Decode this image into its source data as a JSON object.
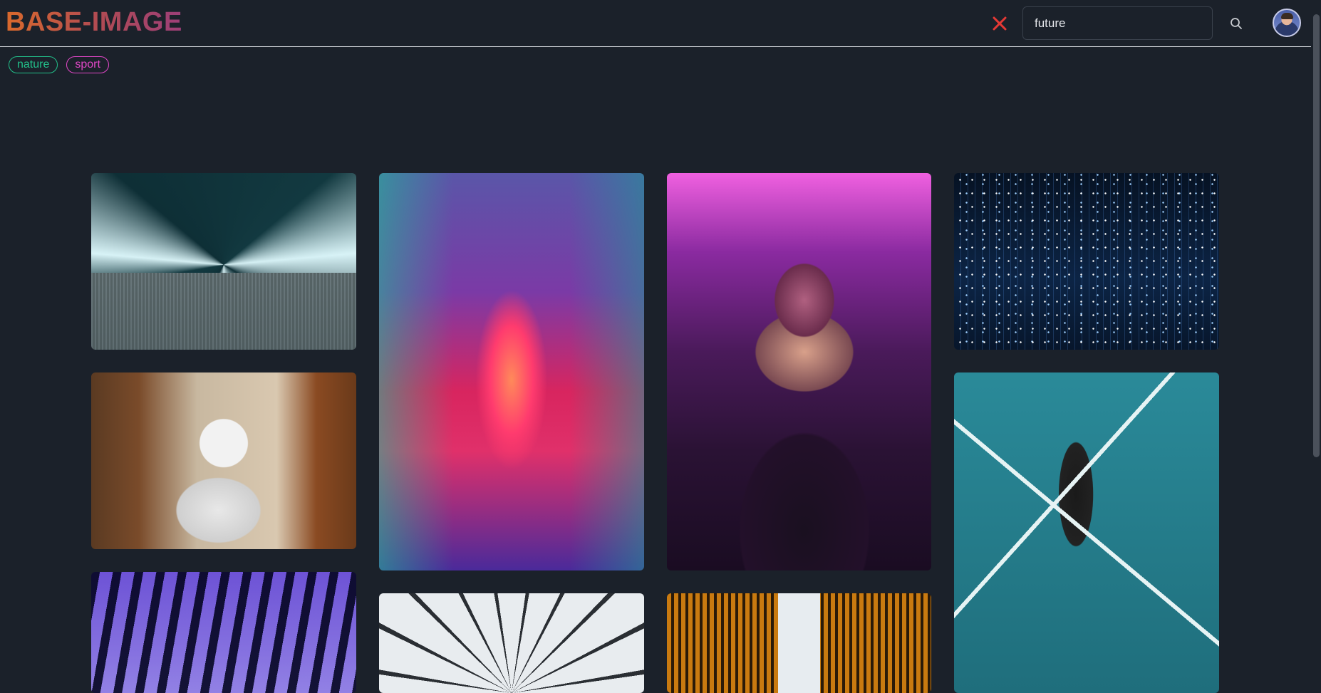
{
  "header": {
    "logo": "BASE-IMAGE",
    "clear_icon": "close-icon",
    "search": {
      "value": "future",
      "placeholder": ""
    },
    "search_icon": "search-icon",
    "avatar_icon": "user-avatar"
  },
  "tags": [
    {
      "label": "nature",
      "color": "#22c08a"
    },
    {
      "label": "sport",
      "color": "#e247c8"
    }
  ],
  "colors": {
    "background": "#1b212a",
    "clear": "#e53935"
  },
  "gallery": [
    {
      "name": "escalator-light-trails"
    },
    {
      "name": "neon-corridor"
    },
    {
      "name": "man-with-futuristic-glasses"
    },
    {
      "name": "starry-installation"
    },
    {
      "name": "white-robot"
    },
    {
      "name": "purple-tunnel"
    },
    {
      "name": "geometric-dome"
    },
    {
      "name": "golden-buildings"
    },
    {
      "name": "vr-headset-person"
    }
  ]
}
